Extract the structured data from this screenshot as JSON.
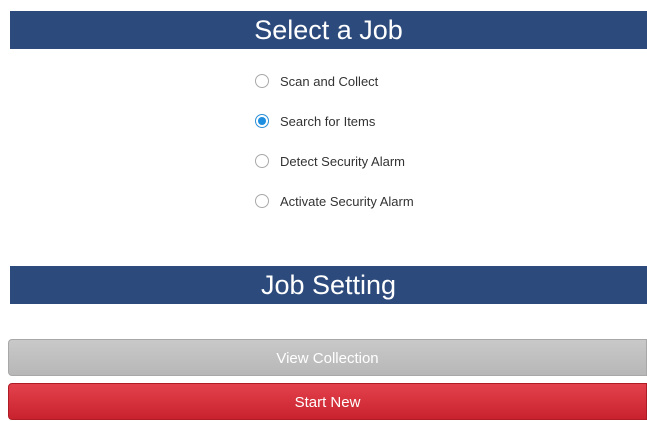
{
  "select_job": {
    "title": "Select a Job",
    "options": [
      {
        "label": "Scan and Collect",
        "selected": false
      },
      {
        "label": "Search for Items",
        "selected": true
      },
      {
        "label": "Detect Security Alarm",
        "selected": false
      },
      {
        "label": "Activate Security Alarm",
        "selected": false
      }
    ]
  },
  "job_setting": {
    "title": "Job Setting"
  },
  "buttons": {
    "view_collection": "View Collection",
    "start_new": "Start New"
  },
  "colors": {
    "header_bg": "#2c4a7c",
    "radio_selected": "#1e8fe0",
    "view_button": "#bdbdbd",
    "start_button": "#d42f3a"
  }
}
